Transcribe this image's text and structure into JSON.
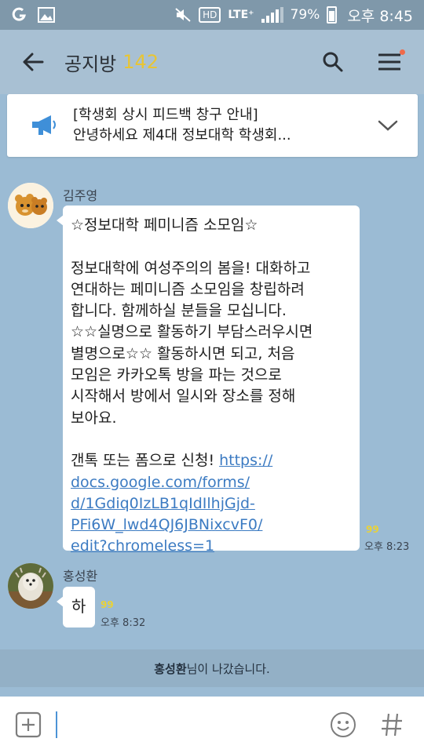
{
  "status_bar": {
    "hd": "HD",
    "network": "LTE⁺",
    "battery": "79%",
    "time": "오후 8:45"
  },
  "header": {
    "title": "공지방",
    "member_count": "142"
  },
  "notice": {
    "line1": "[학생회 상시 피드백 창구 안내]",
    "line2": "안녕하세요 제4대 정보대학 학생회..."
  },
  "messages": [
    {
      "sender": "김주영",
      "lines": [
        "☆정보대학 페미니즘 소모임☆",
        "",
        "정보대학에 여성주의의 봄을! 대화하고",
        "연대하는 페미니즘 소모임을 창립하려",
        "합니다. 함께하실 분들을 모십니다.",
        "☆☆실명으로 활동하기 부담스러우시면",
        "별명으로☆☆ 활동하시면 되고, 처음",
        "모임은 카카오톡 방을 파는 것으로",
        "시작해서 방에서 일시와 장소를 정해",
        "보아요.",
        "",
        "갠톡 또는 폼으로 신청! "
      ],
      "link_lines": [
        "https://",
        "docs.google.com/forms/",
        "d/1Gdiq0IzLB1qIdIlhjGjd-",
        "PFi6W_lwd4QJ6JBNixcvF0/",
        "edit?chromeless=1"
      ],
      "unread": "99",
      "time": "오후 8:23"
    },
    {
      "sender": "홍성환",
      "text": "하",
      "unread": "99",
      "time": "오후 8:32"
    }
  ],
  "system_message": {
    "name": "홍성환",
    "suffix": "님이 나갔습니다."
  },
  "input": {
    "placeholder": ""
  },
  "colors": {
    "chat_background": "#9bbbd4",
    "header_background": "#a8c0d3",
    "member_count": "#e8c534",
    "link": "#3c7bc2",
    "unread": "#e9d238"
  },
  "icons": {
    "back": "arrow-left-icon",
    "search": "search-icon",
    "menu": "hamburger-menu-icon",
    "notice": "megaphone-icon",
    "expand": "chevron-down-icon",
    "attach": "plus-square-icon",
    "emoticon": "smiley-icon",
    "hashtag": "hash-icon"
  }
}
